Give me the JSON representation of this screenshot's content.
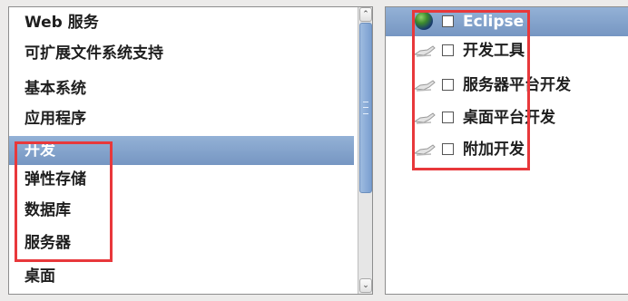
{
  "categories": [
    {
      "label": "Web 服务",
      "selected": false
    },
    {
      "label": "可扩展文件系统支持",
      "selected": false
    },
    {
      "label": "基本系统",
      "selected": false
    },
    {
      "label": "应用程序",
      "selected": false
    },
    {
      "label": "开发",
      "selected": true
    },
    {
      "label": "弹性存储",
      "selected": false
    },
    {
      "label": "数据库",
      "selected": false
    },
    {
      "label": "服务器",
      "selected": false
    },
    {
      "label": "桌面",
      "selected": false
    }
  ],
  "scrollbar": {
    "up_arrow": "⌃",
    "down_arrow": "⌄"
  },
  "packages": [
    {
      "label": "Eclipse",
      "icon": "globe-icon",
      "selected": true,
      "checked": false
    },
    {
      "label": "开发工具",
      "icon": "package-icon",
      "selected": false,
      "checked": false
    },
    {
      "label": "服务器平台开发",
      "icon": "package-icon",
      "selected": false,
      "checked": false
    },
    {
      "label": "桌面平台开发",
      "icon": "package-icon",
      "selected": false,
      "checked": false
    },
    {
      "label": "附加开发",
      "icon": "package-icon",
      "selected": false,
      "checked": false
    }
  ],
  "colors": {
    "selection": "#7a9ac6",
    "annotation": "#e8383b"
  }
}
